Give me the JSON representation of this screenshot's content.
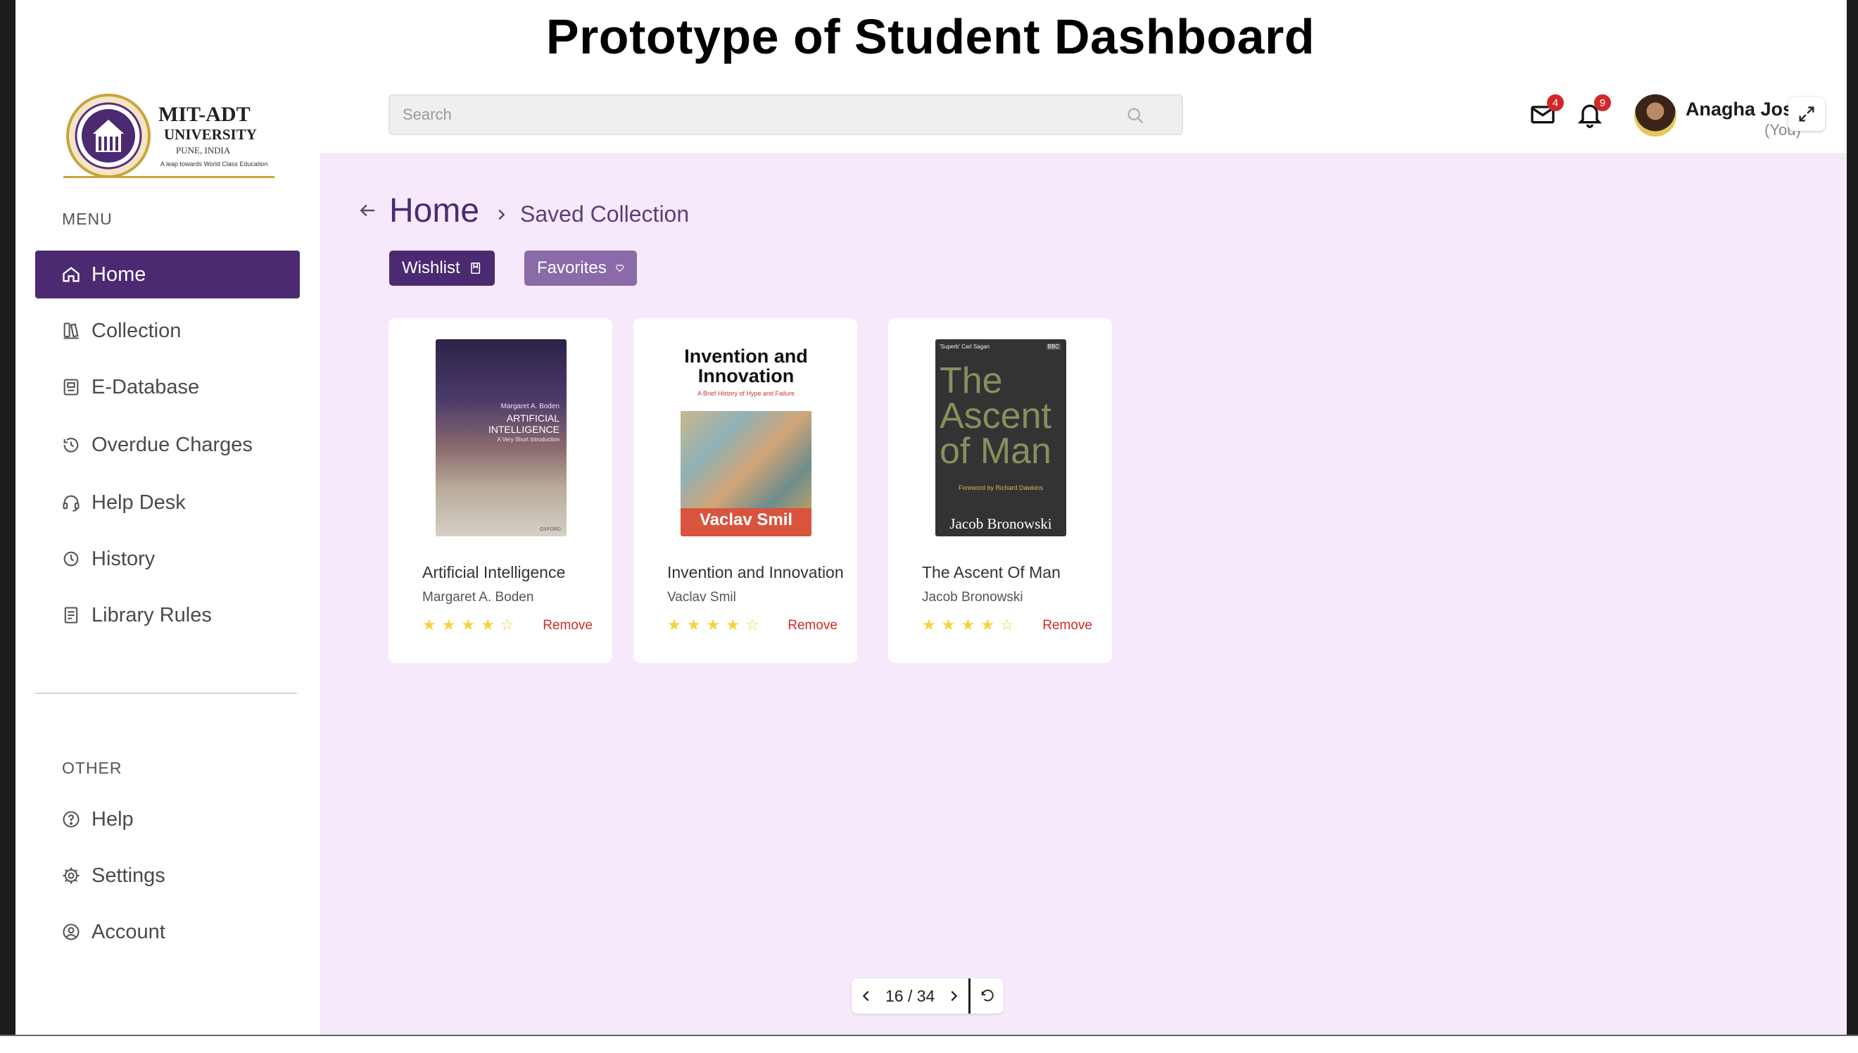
{
  "page_title": "Prototype of Student Dashboard",
  "logo": {
    "name": "MIT-ADT",
    "line2": "UNIVERSITY",
    "line3": "PUNE, INDIA",
    "tagline": "A leap towards World Class Education",
    "seal_text": "MIT UNIVERSITY"
  },
  "sidebar": {
    "menu_heading": "MENU",
    "items": [
      {
        "label": "Home",
        "icon": "home-icon",
        "active": true
      },
      {
        "label": "Collection",
        "icon": "collection-icon"
      },
      {
        "label": "E-Database",
        "icon": "database-icon"
      },
      {
        "label": "Overdue Charges",
        "icon": "overdue-icon"
      },
      {
        "label": "Help Desk",
        "icon": "headset-icon"
      },
      {
        "label": "History",
        "icon": "history-icon"
      },
      {
        "label": "Library Rules",
        "icon": "rules-icon"
      }
    ],
    "other_heading": "OTHER",
    "other_items": [
      {
        "label": "Help",
        "icon": "help-icon"
      },
      {
        "label": "Settings",
        "icon": "gear-icon"
      },
      {
        "label": "Account",
        "icon": "account-icon"
      }
    ]
  },
  "topbar": {
    "search_placeholder": "Search",
    "mail_count": "4",
    "notification_count": "9",
    "user_name": "Anagha Josl",
    "user_sub": "(You)"
  },
  "breadcrumb": {
    "home": "Home",
    "current": "Saved Collection"
  },
  "tabs": {
    "wishlist": "Wishlist",
    "favorites": "Favorites"
  },
  "books": [
    {
      "title": "Artificial Intelligence",
      "author": "Margaret A. Boden",
      "rating": 4,
      "max_rating": 5,
      "remove": "Remove",
      "cover_author": "Margaret A. Boden",
      "cover_title": "ARTIFICIAL INTELLIGENCE",
      "cover_sub": "A Very Short Introduction",
      "cover_publisher": "OXFORD"
    },
    {
      "title": "Invention and Innovation",
      "author": "Vaclav Smil",
      "rating": 4,
      "max_rating": 5,
      "remove": "Remove",
      "cover_title": "Invention and Innovation",
      "cover_sub": "A Brief History of Hype and Failure",
      "cover_author": "Vaclav Smil"
    },
    {
      "title": "The Ascent Of Man",
      "author": "Jacob Bronowski",
      "rating": 4,
      "max_rating": 5,
      "remove": "Remove",
      "cover_quote": "'Superb' Carl Sagan",
      "cover_badge": "BBC",
      "cover_title": "The Ascent of Man",
      "cover_foreword": "Foreword by Richard Dawkins",
      "cover_author": "Jacob Bronowski"
    }
  ],
  "pager": {
    "current": "16",
    "separator": "/",
    "total": "34"
  }
}
